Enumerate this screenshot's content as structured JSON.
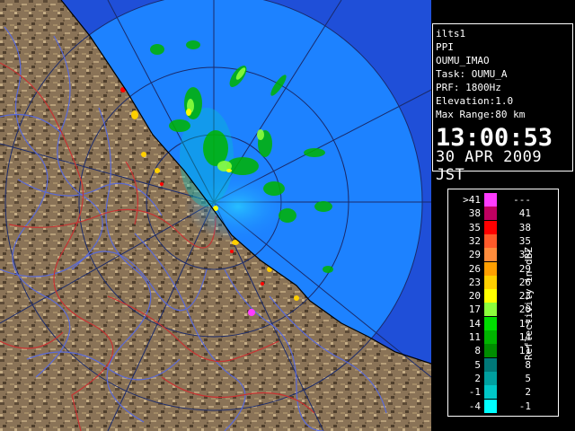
{
  "info": {
    "lines": [
      "ilts1",
      "PPI",
      "OUMU_IMAO",
      "Task: OUMU_A",
      "PRF: 1800Hz",
      "Elevation:1.0",
      "Max Range:80 km"
    ],
    "time": "13:00:53",
    "date": "30 APR 2009 JST"
  },
  "legend": {
    "unit_label": "Reflectivity in dBZ",
    "rows": [
      {
        "low": ">41",
        "high": "---",
        "color": "#ff3cff"
      },
      {
        "low": "38",
        "high": "41",
        "color": "#bf0060"
      },
      {
        "low": "35",
        "high": "38",
        "color": "#ff0000"
      },
      {
        "low": "32",
        "high": "35",
        "color": "#ff5a2a"
      },
      {
        "low": "29",
        "high": "32",
        "color": "#ff8c3c"
      },
      {
        "low": "26",
        "high": "29",
        "color": "#ff9f00"
      },
      {
        "low": "23",
        "high": "26",
        "color": "#ffcf00"
      },
      {
        "low": "20",
        "high": "23",
        "color": "#ffff00"
      },
      {
        "low": "17",
        "high": "20",
        "color": "#8cff3c"
      },
      {
        "low": "14",
        "high": "17",
        "color": "#00dc00"
      },
      {
        "low": "11",
        "high": "14",
        "color": "#00b400"
      },
      {
        "low": "8",
        "high": "11",
        "color": "#008c00"
      },
      {
        "low": "5",
        "high": "8",
        "color": "#007878"
      },
      {
        "low": "2",
        "high": "5",
        "color": "#00a0a0"
      },
      {
        "low": "-1",
        "high": "2",
        "color": "#00c8c8"
      },
      {
        "low": "-4",
        "high": "-1",
        "color": "#00ffff"
      }
    ]
  },
  "colors": {
    "ocean_far": "#1f4fd8",
    "ocean_near": "#1d82ff",
    "land": "#8a7357",
    "river": "#5a6ad8",
    "border": "#c83232"
  }
}
